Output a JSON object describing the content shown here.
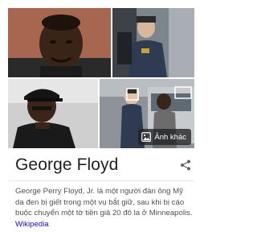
{
  "knowledge_panel": {
    "title": "George Floyd",
    "description": "George Perry Floyd, Jr. là một người đàn ông Mỹ da đen bị giết trong một vụ bắt giữ, sau khi bị cáo buộc chuyển một tờ tiền giả 20 đô la ở Minneapolis.",
    "source_link": "Wikipedia",
    "more_images_label": "Ảnh khác",
    "photos": [
      {
        "name": "portrait-photo"
      },
      {
        "name": "arrest-photo-officer"
      },
      {
        "name": "photo-with-cap"
      },
      {
        "name": "arrest-photo-car"
      }
    ]
  },
  "icons": {
    "share": "share-icon",
    "images": "image-icon"
  },
  "colors": {
    "title": "#202124",
    "body_text": "#4d5156",
    "link": "#1a0dab",
    "divider": "#e8eaed",
    "overlay": "#202124"
  }
}
